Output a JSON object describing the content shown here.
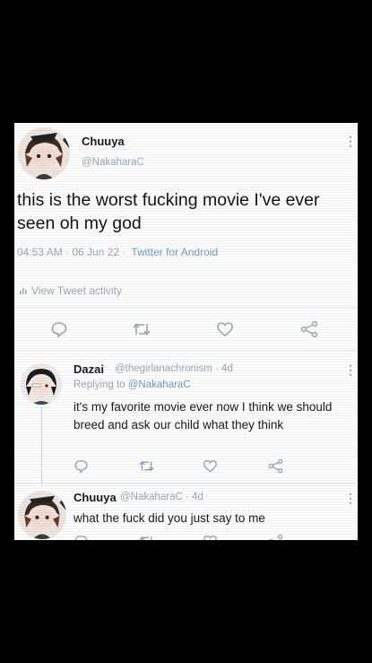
{
  "tweet": {
    "name": "Chuuya",
    "handle": "@NakaharaC",
    "text": "this is the worst fucking movie I've ever seen oh my god",
    "time": "04:53 AM · 06 Jun 22 ·",
    "source": "Twitter for Android",
    "activity": "View Tweet activity"
  },
  "replies": [
    {
      "name": "Dazai",
      "handle": "@thegirlanachronism · 4d",
      "replying_prefix": "Replying to",
      "replying_to": "@NakaharaC",
      "text": "it's my favorite movie ever now I think we should breed and ask our child what they think"
    },
    {
      "name": "Chuuya",
      "handle": "@NakaharaC · 4d",
      "text": "what the fuck did you just say to me"
    }
  ],
  "icons": [
    "reply-icon",
    "retweet-icon",
    "like-icon",
    "share-icon",
    "more-icon",
    "activity-icon"
  ],
  "colors": {
    "link": "#6f9cc4",
    "muted": "#9aa8b3",
    "text": "#141414",
    "background": "#000000",
    "card": "#ffffff"
  }
}
